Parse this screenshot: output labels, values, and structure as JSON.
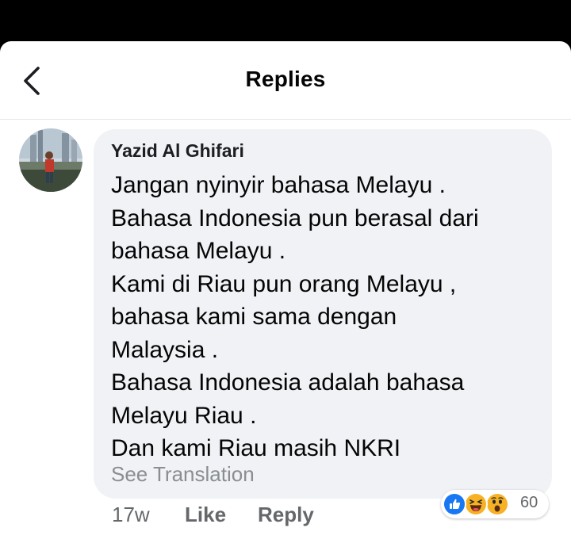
{
  "header": {
    "title": "Replies",
    "back_icon": "chevron-left-icon"
  },
  "comment": {
    "author": "Yazid Al Ghifari",
    "lines": [
      "Jangan nyinyir bahasa Melayu .",
      "Bahasa Indonesia pun berasal dari",
      "bahasa Melayu .",
      "Kami di Riau pun orang Melayu ,",
      "bahasa kami sama dengan",
      "Malaysia .",
      "Bahasa Indonesia adalah bahasa",
      "Melayu Riau .",
      "Dan kami Riau masih NKRI"
    ],
    "see_translation": "See Translation",
    "time": "17w",
    "like_label": "Like",
    "reply_label": "Reply",
    "reactions": {
      "icons": [
        "like-icon",
        "haha-icon",
        "wow-icon"
      ],
      "count": "60"
    }
  },
  "colors": {
    "bubble": "#f0f2f5",
    "like_blue": "#1877f2",
    "emoji_yellow": "#f7b125",
    "muted_text": "#65676b"
  }
}
